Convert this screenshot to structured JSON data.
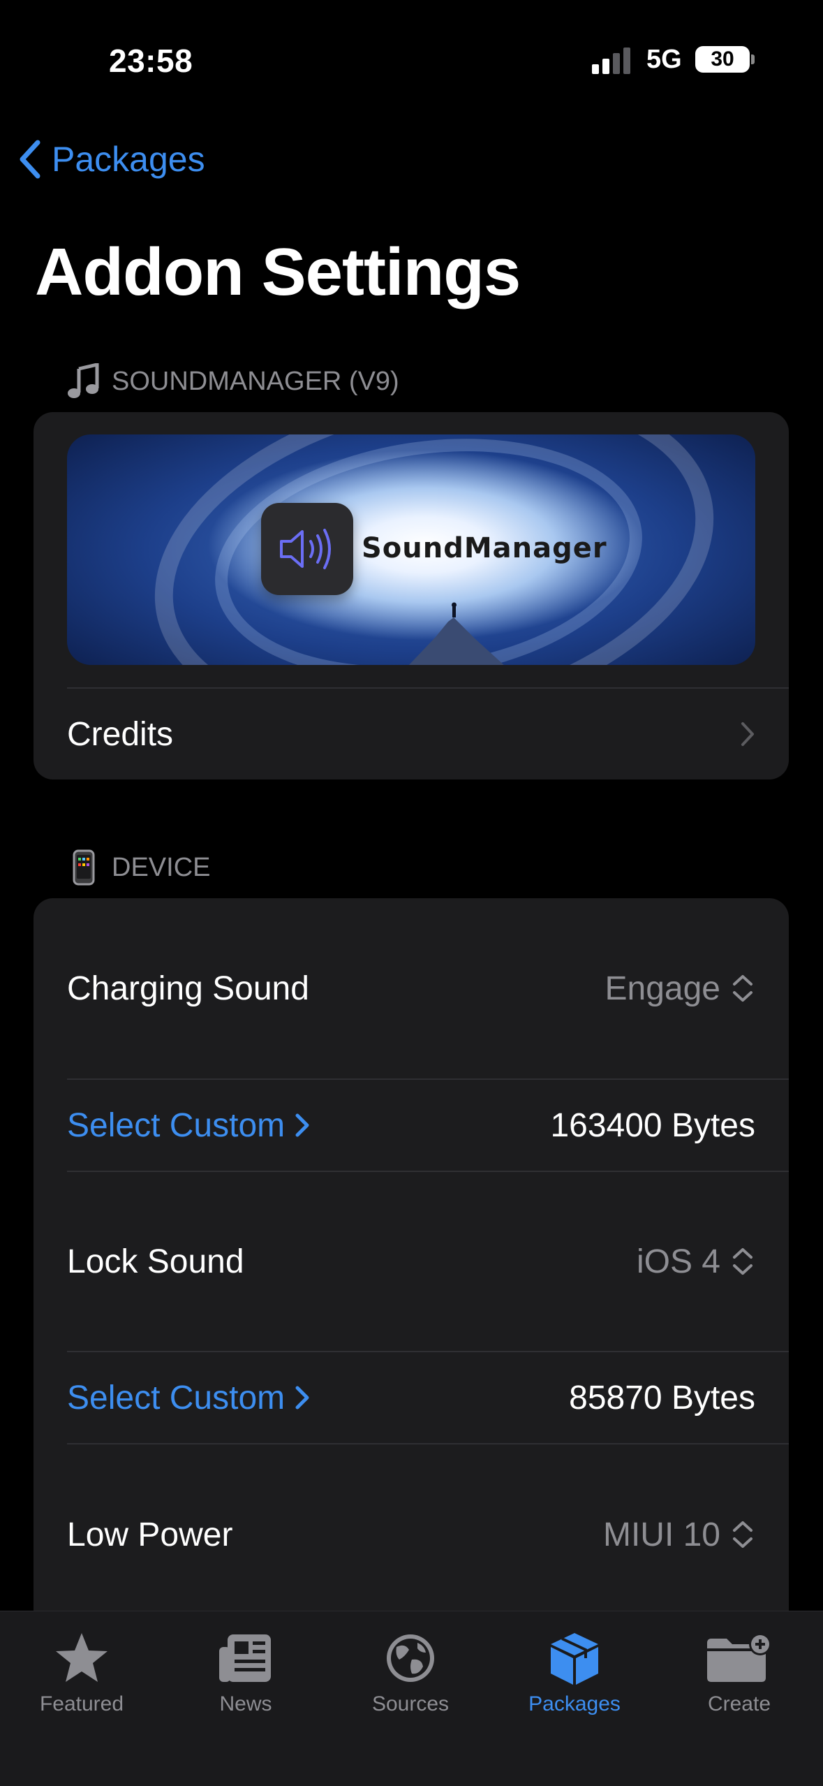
{
  "status_bar": {
    "time": "23:58",
    "network": "5G",
    "battery": "30"
  },
  "nav": {
    "back_label": "Packages",
    "title": "Addon Settings"
  },
  "sections": {
    "soundmanager": {
      "header": "SOUNDMANAGER (V9)",
      "banner_title": "SoundManager",
      "credits_label": "Credits"
    },
    "device": {
      "header": "DEVICE",
      "rows": [
        {
          "label": "Charging Sound",
          "value": "Engage"
        },
        {
          "label": "Select Custom",
          "value": "163400 Bytes"
        },
        {
          "label": "Lock Sound",
          "value": "iOS 4"
        },
        {
          "label": "Select Custom",
          "value": "85870 Bytes"
        },
        {
          "label": "Low Power",
          "value": "MIUI 10"
        }
      ]
    }
  },
  "tabs": [
    {
      "label": "Featured",
      "icon": "star-icon",
      "active": false
    },
    {
      "label": "News",
      "icon": "newspaper-icon",
      "active": false
    },
    {
      "label": "Sources",
      "icon": "globe-icon",
      "active": false
    },
    {
      "label": "Packages",
      "icon": "box-icon",
      "active": true
    },
    {
      "label": "Create",
      "icon": "folder-plus-icon",
      "active": false
    }
  ],
  "colors": {
    "accent": "#3d8ef0",
    "card": "#1c1c1e",
    "secondary_text": "#8e8e93"
  }
}
